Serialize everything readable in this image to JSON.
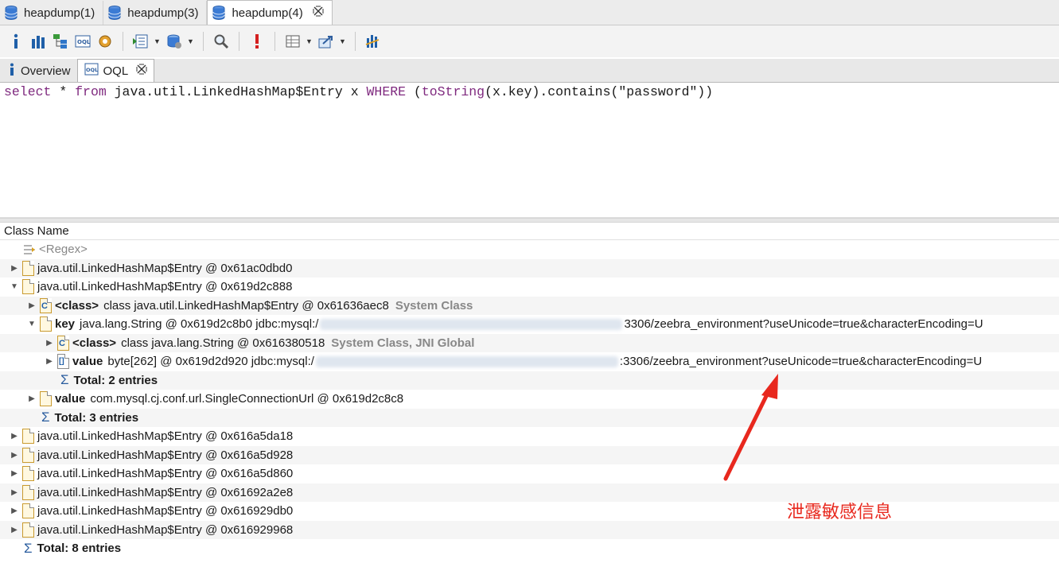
{
  "editor_tabs": [
    {
      "label": "heapdump(1)",
      "active": false
    },
    {
      "label": "heapdump(3)",
      "active": false
    },
    {
      "label": "heapdump(4)",
      "active": true
    }
  ],
  "toolbar_icons": [
    "info-icon",
    "histogram-icon",
    "dominator-tree-icon",
    "oql-icon",
    "thread-overview-icon",
    "run-report-icon",
    "heap-dump-overview-icon",
    "search-icon",
    "leak-suspects-icon",
    "grouping-icon",
    "export-icon",
    "calculate-retained-icon"
  ],
  "query_tabs": [
    {
      "label": "Overview",
      "icon": "info-icon",
      "active": false
    },
    {
      "label": "OQL",
      "icon": "oql-icon",
      "active": true
    }
  ],
  "query": {
    "select": "select",
    "star": " * ",
    "from": "from",
    "cls": " java.util.LinkedHashMap$Entry x ",
    "where": "WHERE",
    "p1": " (",
    "fn": "toString",
    "rest": "(x.key).contains(\"password\"))"
  },
  "results": {
    "column_header": "Class Name",
    "regex_placeholder": "<Regex>",
    "rows": [
      {
        "text": "java.util.LinkedHashMap$Entry @ 0x61ac0dbd0"
      },
      {
        "text": "java.util.LinkedHashMap$Entry @ 0x619d2c888"
      },
      {
        "label": "<class>",
        "text": "class java.util.LinkedHashMap$Entry @ 0x61636aec8",
        "note": "System Class"
      },
      {
        "label": "key",
        "text": "java.lang.String @ 0x619d2c8b0  jdbc:mysql:/",
        "suffix": "3306/zeebra_environment?useUnicode=true&characterEncoding=U"
      },
      {
        "label": "<class>",
        "text": "class java.lang.String @ 0x616380518",
        "note": "System Class, JNI Global"
      },
      {
        "label": "value",
        "text": "byte[262] @ 0x619d2d920  jdbc:mysql:/",
        "suffix": ":3306/zeebra_environment?useUnicode=true&characterEncoding=U"
      },
      {
        "label": "Total: 2 entries"
      },
      {
        "label": "value",
        "text": "com.mysql.cj.conf.url.SingleConnectionUrl @ 0x619d2c8c8"
      },
      {
        "label": "Total: 3 entries"
      },
      {
        "text": "java.util.LinkedHashMap$Entry @ 0x616a5da18"
      },
      {
        "text": "java.util.LinkedHashMap$Entry @ 0x616a5d928"
      },
      {
        "text": "java.util.LinkedHashMap$Entry @ 0x616a5d860"
      },
      {
        "text": "java.util.LinkedHashMap$Entry @ 0x61692a2e8"
      },
      {
        "text": "java.util.LinkedHashMap$Entry @ 0x616929db0"
      },
      {
        "text": "java.util.LinkedHashMap$Entry @ 0x616929968"
      },
      {
        "label": "Total: 8 entries"
      }
    ]
  },
  "annotation": "泄露敏感信息",
  "colors": {
    "keyword": "#7f2a7f",
    "annotation": "#e8281e",
    "db_icon": "#3b7bd4"
  }
}
